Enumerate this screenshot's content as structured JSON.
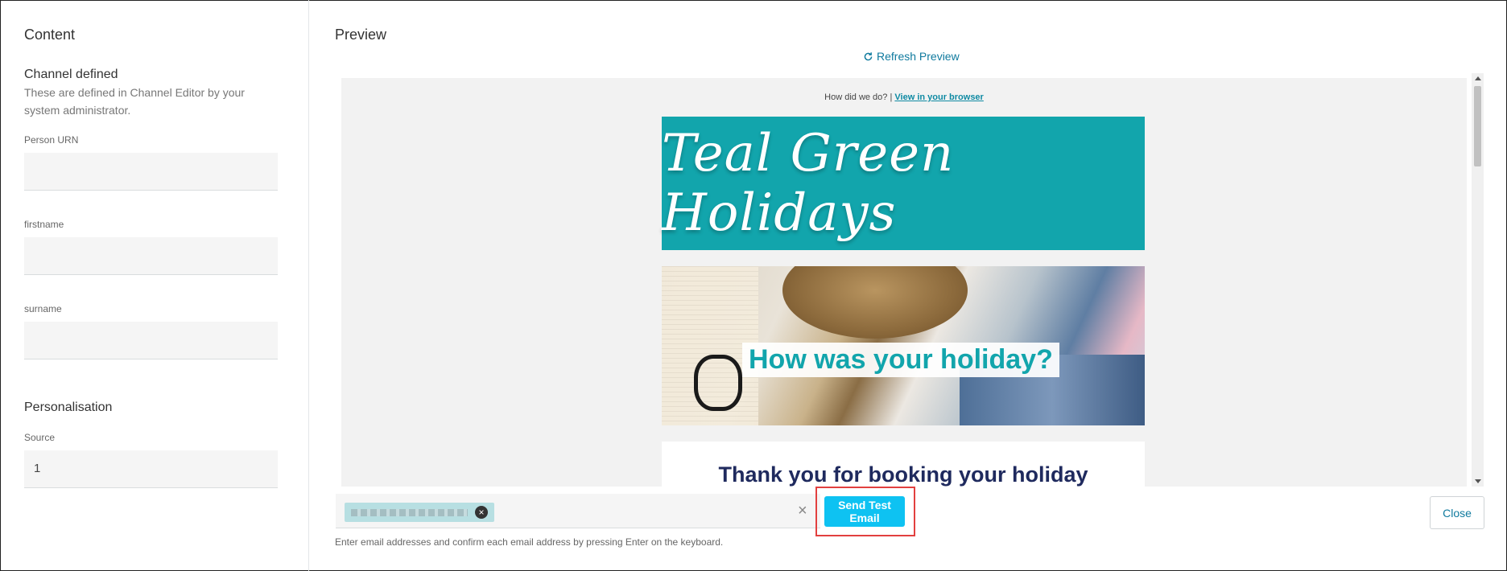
{
  "content_panel": {
    "title": "Content",
    "channel_defined": {
      "heading": "Channel defined",
      "description": "These are defined in Channel Editor by your system administrator."
    },
    "fields": [
      {
        "label": "Person URN",
        "value": ""
      },
      {
        "label": "firstname",
        "value": ""
      },
      {
        "label": "surname",
        "value": ""
      }
    ],
    "personalisation": {
      "heading": "Personalisation",
      "source_label": "Source",
      "source_value": "1"
    }
  },
  "preview_panel": {
    "title": "Preview",
    "refresh_label": "Refresh Preview",
    "refresh_icon": "refresh-icon",
    "email": {
      "top_text": "How did we do? |",
      "browser_link": "View in your browser",
      "banner_text": "Teal Green Holidays",
      "hero_headline": "How was your holiday?",
      "thanks_heading": "Thank you for booking your holiday"
    }
  },
  "send_bar": {
    "helper_text": "Enter email addresses and confirm each email address by pressing Enter on the keyboard.",
    "send_label": "Send Test Email",
    "clear_symbol": "×",
    "chip_remove_symbol": "×",
    "close_label": "Close"
  },
  "colors": {
    "accent": "#0ec2f2",
    "brand_teal": "#12a5ac",
    "link": "#0f7a9e",
    "highlight": "#e2403f"
  }
}
